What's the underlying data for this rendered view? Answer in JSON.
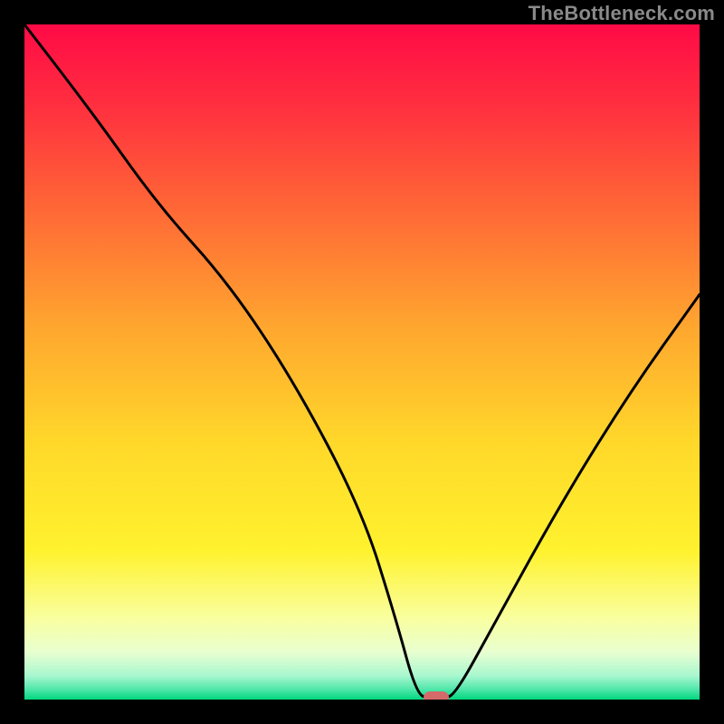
{
  "watermark": "TheBottleneck.com",
  "chart_data": {
    "type": "line",
    "title": "",
    "xlabel": "",
    "ylabel": "",
    "xlim": [
      0,
      100
    ],
    "ylim": [
      0,
      100
    ],
    "grid": false,
    "legend": false,
    "x": [
      0,
      10,
      20,
      30,
      40,
      50,
      55,
      58,
      60,
      62,
      64,
      70,
      80,
      90,
      100
    ],
    "values": [
      100,
      87,
      73,
      62,
      47,
      28,
      12,
      1,
      0,
      0,
      1,
      12,
      30,
      46,
      60
    ],
    "marker": {
      "x": 61,
      "y": 0
    },
    "gradient_stops": [
      {
        "pos": 0.0,
        "color": "#ff0a46"
      },
      {
        "pos": 0.12,
        "color": "#ff2f3f"
      },
      {
        "pos": 0.28,
        "color": "#ff6a36"
      },
      {
        "pos": 0.45,
        "color": "#ffa72f"
      },
      {
        "pos": 0.62,
        "color": "#ffd82a"
      },
      {
        "pos": 0.78,
        "color": "#fff22e"
      },
      {
        "pos": 0.88,
        "color": "#f9ffa0"
      },
      {
        "pos": 0.93,
        "color": "#e8ffd0"
      },
      {
        "pos": 0.965,
        "color": "#a8f7cf"
      },
      {
        "pos": 0.985,
        "color": "#4fe6a9"
      },
      {
        "pos": 1.0,
        "color": "#00d77f"
      }
    ]
  }
}
